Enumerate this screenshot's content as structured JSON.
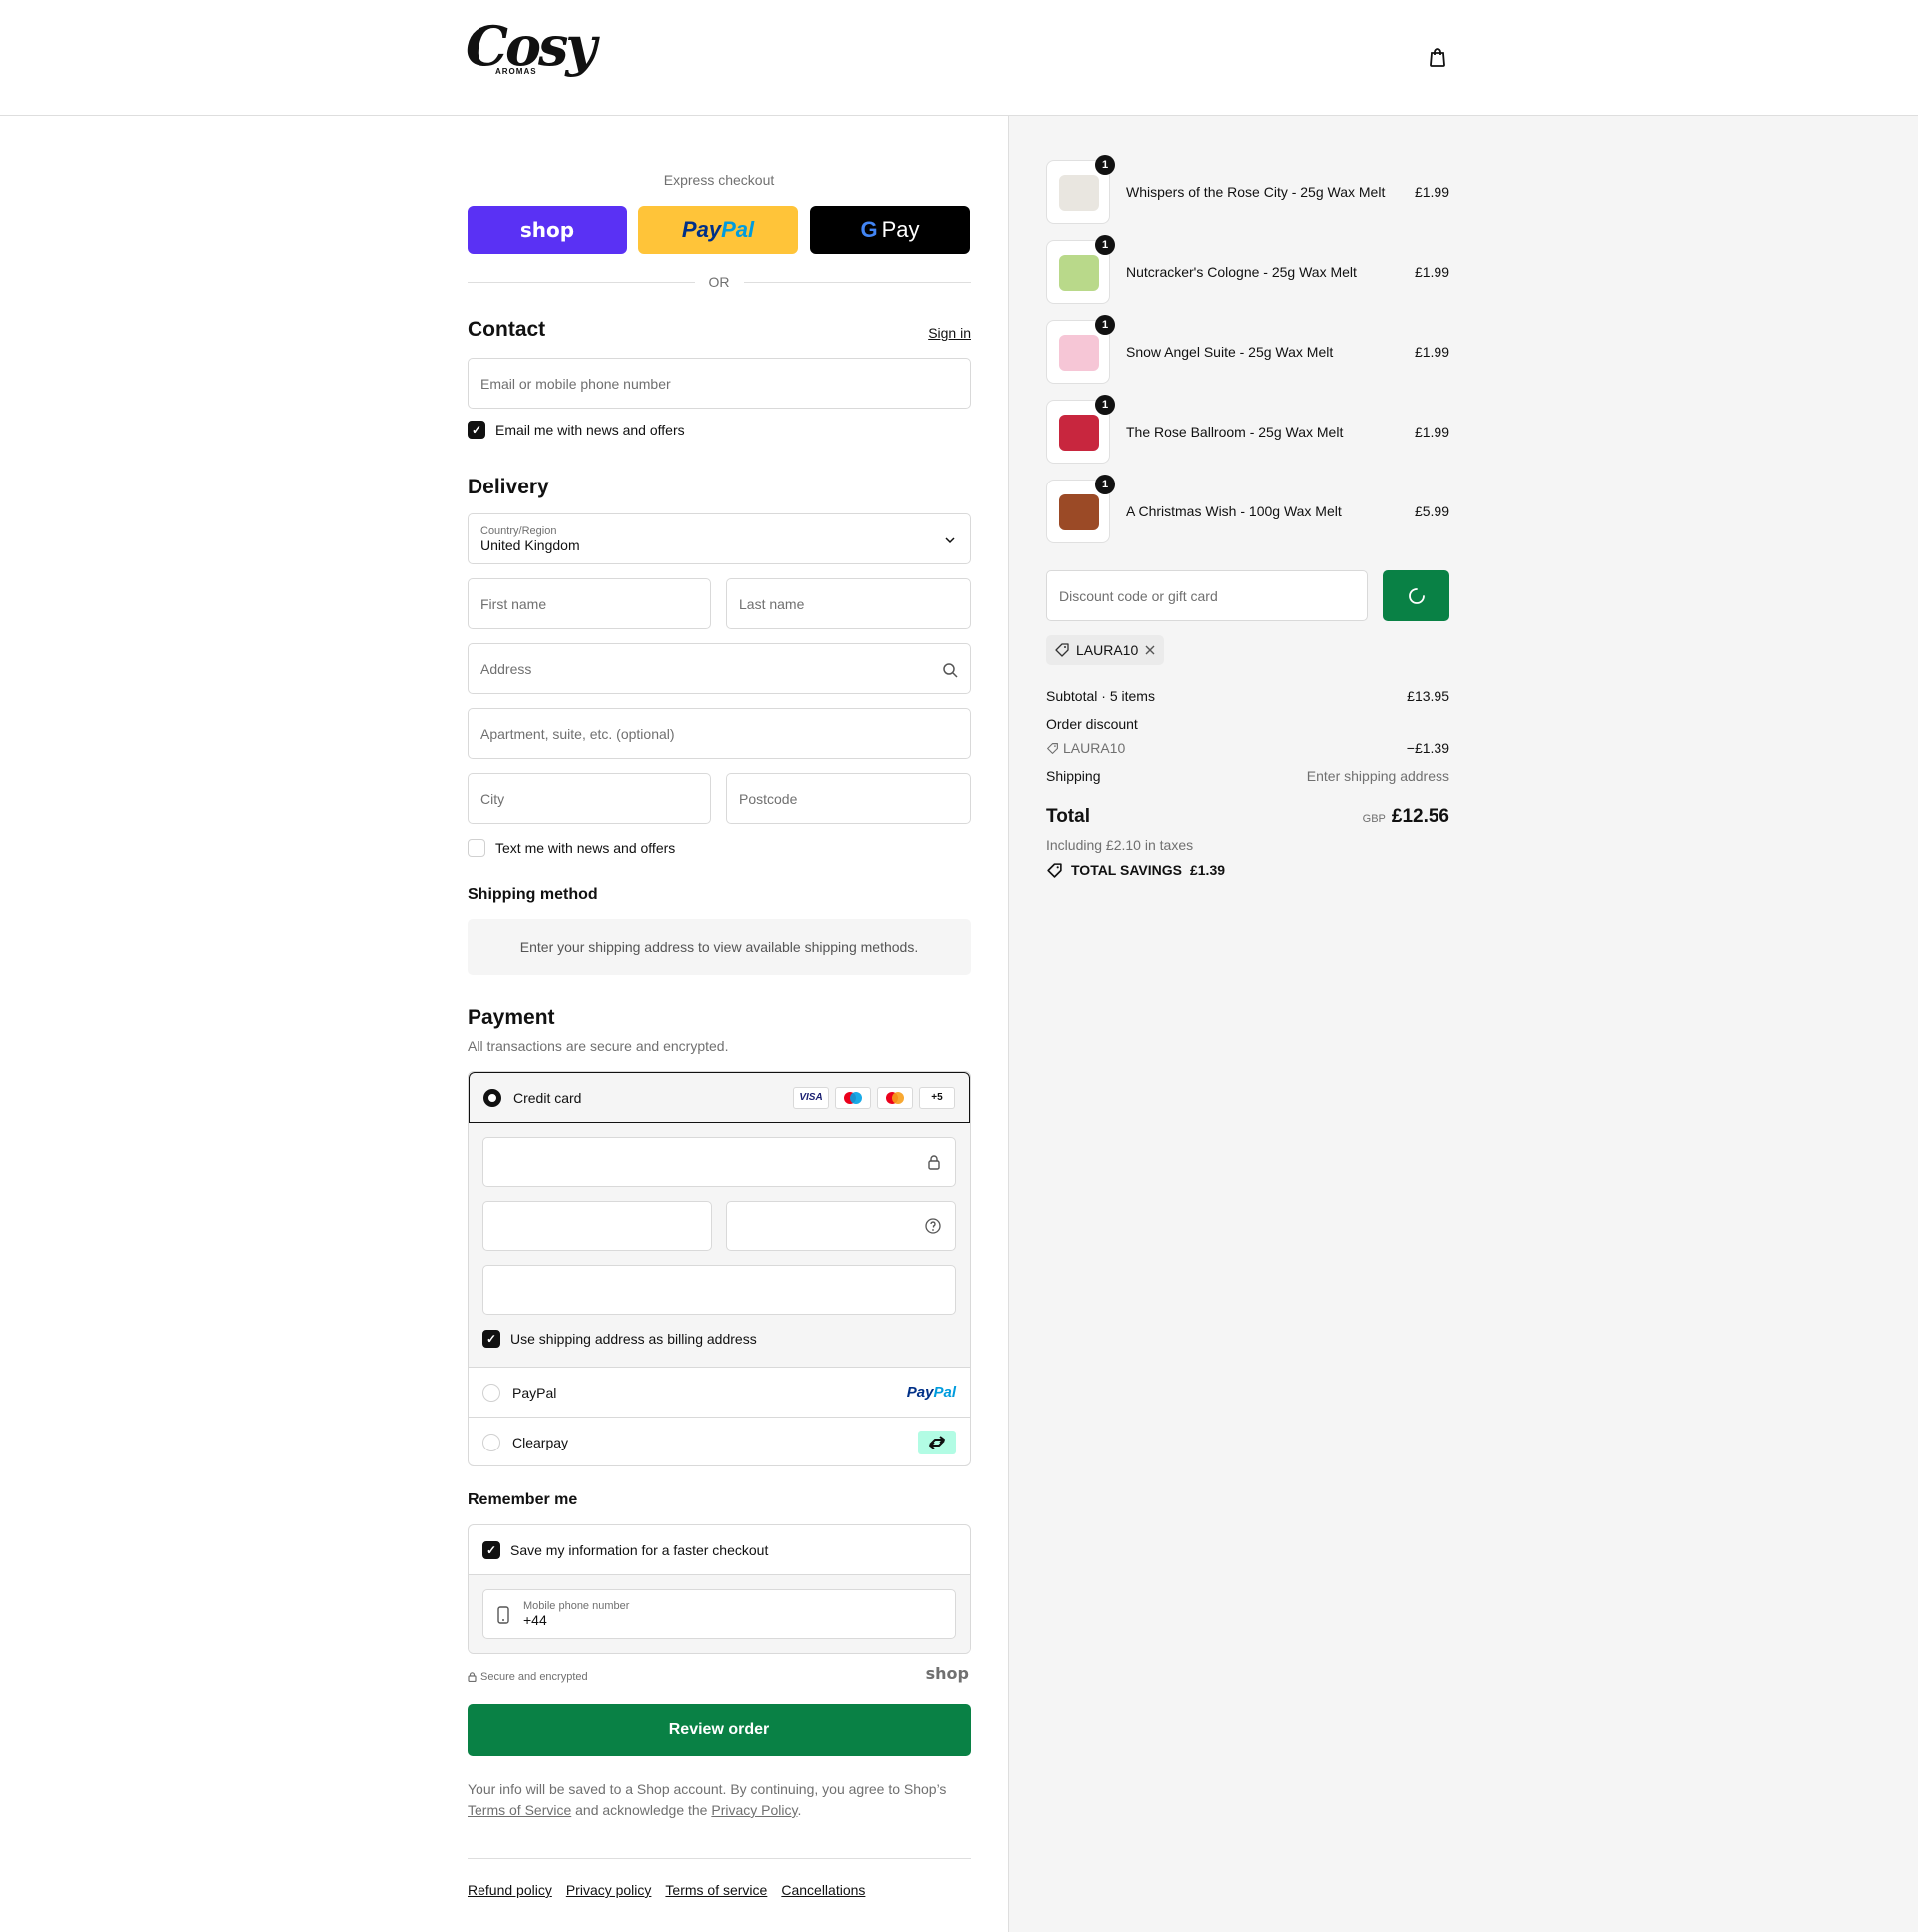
{
  "header": {
    "logo_text": "Cosy",
    "logo_subtext": "AROMAS",
    "cart_icon": "shopping-bag-icon"
  },
  "express": {
    "title": "Express checkout",
    "shop_label": "shop",
    "paypal_label_a": "Pay",
    "paypal_label_b": "Pal",
    "gpay_g": "G",
    "gpay_label": "Pay",
    "or_label": "OR"
  },
  "contact": {
    "title": "Contact",
    "signin_label": "Sign in",
    "email_placeholder": "Email or mobile phone number",
    "newsletter_label": "Email me with news and offers",
    "newsletter_checked": true
  },
  "delivery": {
    "title": "Delivery",
    "country_label": "Country/Region",
    "country_value": "United Kingdom",
    "first_name_placeholder": "First name",
    "last_name_placeholder": "Last name",
    "address_placeholder": "Address",
    "apartment_placeholder": "Apartment, suite, etc. (optional)",
    "city_placeholder": "City",
    "postcode_placeholder": "Postcode",
    "sms_label": "Text me with news and offers",
    "sms_checked": false
  },
  "shipping_method": {
    "title": "Shipping method",
    "notice": "Enter your shipping address to view available shipping methods."
  },
  "payment": {
    "title": "Payment",
    "subtitle": "All transactions are secure and encrypted.",
    "credit_card_label": "Credit card",
    "card_badges": [
      "VISA",
      "Maestro",
      "Mastercard",
      "+5"
    ],
    "more_cards": "+5",
    "visa": "VISA",
    "billing_label": "Use shipping address as billing address",
    "paypal_option": "PayPal",
    "paypal_logo_a": "Pay",
    "paypal_logo_b": "Pal",
    "clearpay_option": "Clearpay"
  },
  "remember": {
    "title": "Remember me",
    "save_label": "Save my information for a faster checkout",
    "phone_label": "Mobile phone number",
    "phone_value": "+44",
    "secure_label": "Secure and encrypted",
    "shop_brand": "shop"
  },
  "review_button": "Review order",
  "legal": {
    "text_a": "Your info will be saved to a Shop account. By continuing, you agree to Shop’s",
    "terms_link": "Terms of Service",
    "text_b": "and acknowledge the",
    "privacy_link": "Privacy Policy",
    "text_c": "."
  },
  "footer_links": [
    "Refund policy",
    "Privacy policy",
    "Terms of service",
    "Cancellations"
  ],
  "order": {
    "items": [
      {
        "name": "Whispers of the Rose City - 25g Wax Melt",
        "price": "£1.99",
        "qty": "1",
        "color": "#e9e6e0"
      },
      {
        "name": "Nutcracker's Cologne - 25g Wax Melt",
        "price": "£1.99",
        "qty": "1",
        "color": "#b9d98a"
      },
      {
        "name": "Snow Angel Suite - 25g Wax Melt",
        "price": "£1.99",
        "qty": "1",
        "color": "#f6c6d6"
      },
      {
        "name": "The Rose Ballroom - 25g Wax Melt",
        "price": "£1.99",
        "qty": "1",
        "color": "#c8263e"
      },
      {
        "name": "A Christmas Wish - 100g Wax Melt",
        "price": "£5.99",
        "qty": "1",
        "color": "#9b4a26"
      }
    ],
    "discount_placeholder": "Discount code or gift card",
    "applied_code": "LAURA10",
    "subtotal_label": "Subtotal · 5 items",
    "subtotal_value": "£13.95",
    "order_discount_label": "Order discount",
    "discount_code": "LAURA10",
    "discount_value": "−£1.39",
    "shipping_label": "Shipping",
    "shipping_value": "Enter shipping address",
    "total_label": "Total",
    "currency": "GBP",
    "total_value": "£12.56",
    "taxes_note": "Including £2.10 in taxes",
    "savings_label": "TOTAL SAVINGS",
    "savings_value": "£1.39"
  },
  "colors": {
    "accent_green": "#098145",
    "shop_purple": "#5a31f4",
    "paypal_yellow": "#ffc439",
    "clearpay_mint": "#b2fce4"
  }
}
